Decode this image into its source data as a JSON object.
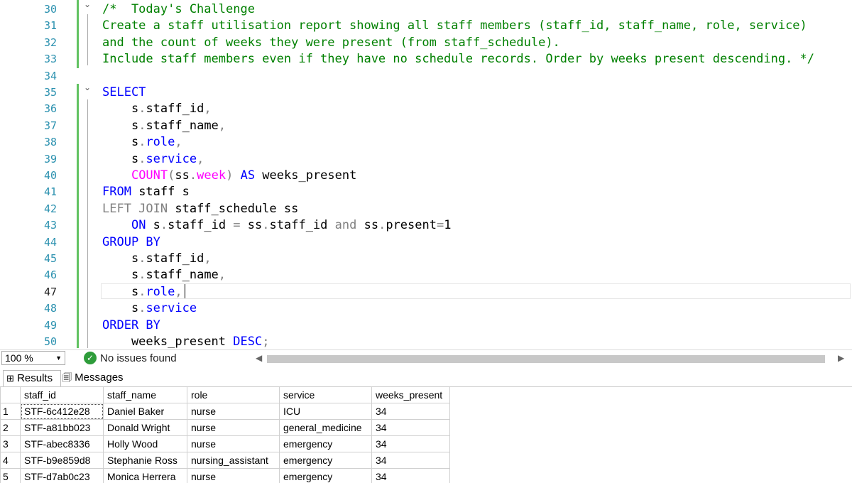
{
  "editor": {
    "lines": [
      {
        "num": "30",
        "tokens": [
          {
            "t": "/*  Today's Challenge",
            "c": "cm"
          }
        ]
      },
      {
        "num": "31",
        "tokens": [
          {
            "t": "Create a staff utilisation report showing all staff members (staff_id, staff_name, role, service)",
            "c": "cm"
          }
        ]
      },
      {
        "num": "32",
        "tokens": [
          {
            "t": "and the count of weeks they were present (from staff_schedule).",
            "c": "cm"
          }
        ]
      },
      {
        "num": "33",
        "tokens": [
          {
            "t": "Include staff members even if they have no schedule records. Order by weeks present descending. */",
            "c": "cm"
          }
        ]
      },
      {
        "num": "34",
        "tokens": []
      },
      {
        "num": "35",
        "tokens": [
          {
            "t": "SELECT",
            "c": "kw"
          }
        ]
      },
      {
        "num": "36",
        "tokens": [
          {
            "t": "    s",
            "c": ""
          },
          {
            "t": ".",
            "c": "gr"
          },
          {
            "t": "staff_id",
            "c": ""
          },
          {
            "t": ",",
            "c": "gr"
          }
        ]
      },
      {
        "num": "37",
        "tokens": [
          {
            "t": "    s",
            "c": ""
          },
          {
            "t": ".",
            "c": "gr"
          },
          {
            "t": "staff_name",
            "c": ""
          },
          {
            "t": ",",
            "c": "gr"
          }
        ]
      },
      {
        "num": "38",
        "tokens": [
          {
            "t": "    s",
            "c": ""
          },
          {
            "t": ".",
            "c": "gr"
          },
          {
            "t": "role",
            "c": "kw"
          },
          {
            "t": ",",
            "c": "gr"
          }
        ]
      },
      {
        "num": "39",
        "tokens": [
          {
            "t": "    s",
            "c": ""
          },
          {
            "t": ".",
            "c": "gr"
          },
          {
            "t": "service",
            "c": "kw"
          },
          {
            "t": ",",
            "c": "gr"
          }
        ]
      },
      {
        "num": "40",
        "tokens": [
          {
            "t": "    ",
            "c": ""
          },
          {
            "t": "COUNT",
            "c": "fn"
          },
          {
            "t": "(",
            "c": "gr"
          },
          {
            "t": "ss",
            "c": ""
          },
          {
            "t": ".",
            "c": "gr"
          },
          {
            "t": "week",
            "c": "sys"
          },
          {
            "t": ")",
            "c": "gr"
          },
          {
            "t": " ",
            "c": ""
          },
          {
            "t": "AS",
            "c": "kw"
          },
          {
            "t": " weeks_present",
            "c": ""
          }
        ]
      },
      {
        "num": "41",
        "tokens": [
          {
            "t": "FROM",
            "c": "kw"
          },
          {
            "t": " staff s",
            "c": ""
          }
        ]
      },
      {
        "num": "42",
        "tokens": [
          {
            "t": "LEFT JOIN",
            "c": "gr"
          },
          {
            "t": " staff_schedule ss",
            "c": ""
          }
        ]
      },
      {
        "num": "43",
        "tokens": [
          {
            "t": "    ",
            "c": ""
          },
          {
            "t": "ON",
            "c": "kw"
          },
          {
            "t": " s",
            "c": ""
          },
          {
            "t": ".",
            "c": "gr"
          },
          {
            "t": "staff_id ",
            "c": ""
          },
          {
            "t": "=",
            "c": "gr"
          },
          {
            "t": " ss",
            "c": ""
          },
          {
            "t": ".",
            "c": "gr"
          },
          {
            "t": "staff_id ",
            "c": ""
          },
          {
            "t": "and",
            "c": "gr"
          },
          {
            "t": " ss",
            "c": ""
          },
          {
            "t": ".",
            "c": "gr"
          },
          {
            "t": "present",
            "c": ""
          },
          {
            "t": "=",
            "c": "gr"
          },
          {
            "t": "1",
            "c": ""
          }
        ]
      },
      {
        "num": "44",
        "tokens": [
          {
            "t": "GROUP BY",
            "c": "kw"
          }
        ]
      },
      {
        "num": "45",
        "tokens": [
          {
            "t": "    s",
            "c": ""
          },
          {
            "t": ".",
            "c": "gr"
          },
          {
            "t": "staff_id",
            "c": ""
          },
          {
            "t": ",",
            "c": "gr"
          }
        ]
      },
      {
        "num": "46",
        "tokens": [
          {
            "t": "    s",
            "c": ""
          },
          {
            "t": ".",
            "c": "gr"
          },
          {
            "t": "staff_name",
            "c": ""
          },
          {
            "t": ",",
            "c": "gr"
          }
        ]
      },
      {
        "num": "47",
        "tokens": [
          {
            "t": "    s",
            "c": ""
          },
          {
            "t": ".",
            "c": "gr"
          },
          {
            "t": "role",
            "c": "kw"
          },
          {
            "t": ",",
            "c": "gr"
          }
        ]
      },
      {
        "num": "48",
        "tokens": [
          {
            "t": "    s",
            "c": ""
          },
          {
            "t": ".",
            "c": "gr"
          },
          {
            "t": "service",
            "c": "kw"
          }
        ]
      },
      {
        "num": "49",
        "tokens": [
          {
            "t": "ORDER BY",
            "c": "kw"
          }
        ]
      },
      {
        "num": "50",
        "tokens": [
          {
            "t": "    weeks_present ",
            "c": ""
          },
          {
            "t": "DESC",
            "c": "kw"
          },
          {
            "t": ";",
            "c": "gr"
          }
        ]
      }
    ]
  },
  "status": {
    "zoom": "100 %",
    "issues": "No issues found"
  },
  "tabs": {
    "results": "Results",
    "messages": "Messages"
  },
  "grid": {
    "columns": [
      "staff_id",
      "staff_name",
      "role",
      "service",
      "weeks_present"
    ],
    "rows": [
      {
        "n": "1",
        "cells": [
          "STF-6c412e28",
          "Daniel Baker",
          "nurse",
          "ICU",
          "34"
        ]
      },
      {
        "n": "2",
        "cells": [
          "STF-a81bb023",
          "Donald Wright",
          "nurse",
          "general_medicine",
          "34"
        ]
      },
      {
        "n": "3",
        "cells": [
          "STF-abec8336",
          "Holly Wood",
          "nurse",
          "emergency",
          "34"
        ]
      },
      {
        "n": "4",
        "cells": [
          "STF-b9e859d8",
          "Stephanie Ross",
          "nursing_assistant",
          "emergency",
          "34"
        ]
      },
      {
        "n": "5",
        "cells": [
          "STF-d7ab0c23",
          "Monica Herrera",
          "nurse",
          "emergency",
          "34"
        ]
      }
    ]
  },
  "colors": {
    "keyword": "#0000ff",
    "comment": "#008000",
    "function": "#ff00ff",
    "line_number": "#2b91af",
    "change_bar": "#61c261",
    "issues_ok": "#2e9c3a"
  },
  "icons": [
    "fold-arrow-icon",
    "check-circle-icon",
    "grid-icon",
    "messages-icon",
    "dropdown-arrow-icon",
    "scroll-left-icon",
    "scroll-right-icon"
  ]
}
